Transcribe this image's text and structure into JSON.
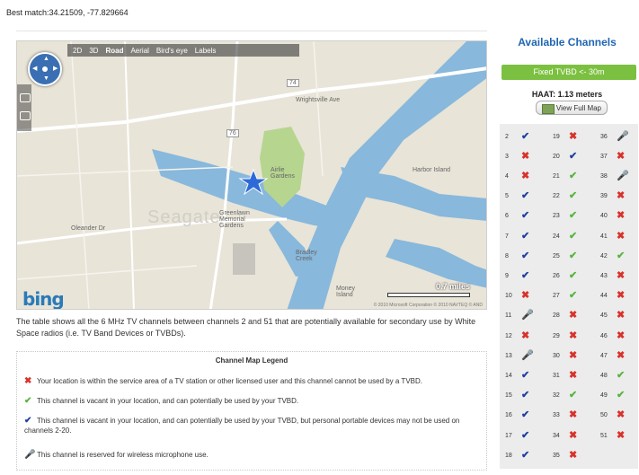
{
  "header": {
    "best_match": "Best match:34.21509, -77.829664"
  },
  "map": {
    "toolbar": [
      "2D",
      "3D",
      "Road",
      "Aerial",
      "Bird's eye",
      "Labels"
    ],
    "toolbar_active": "Road",
    "labels": {
      "town": "Seagate",
      "street1": "Wrightsville Ave",
      "street2": "Oleander Dr",
      "park": "Airlie Gardens",
      "cemetery": "Greenlawn Memorial Gardens",
      "harbor": "Harbor Island",
      "bradley": "Bradley Creek",
      "money": "Money Island",
      "route1": "74",
      "route2": "76"
    },
    "logo": "bing",
    "scale": "0.7 miles",
    "copyright": "© 2010 Microsoft Corporation   © 2010 NAVTEQ   © AND"
  },
  "description": "The table shows all the 6 MHz TV channels between channels 2 and 51 that are potentially available for secondary use by White Space radios (i.e. TV Band Devices or TVBDs).",
  "legend": {
    "title": "Channel Map Legend",
    "items": [
      {
        "icon": "x",
        "text": "Your location is within the service area of a TV station or other licensed user and this channel cannot be used by a TVBD."
      },
      {
        "icon": "g",
        "text": "This channel is vacant in your location, and can potentially be used by your TVBD."
      },
      {
        "icon": "b",
        "text": "This channel is vacant in your location, and can potentially be used by your TVBD, but personal portable devices may not be used on channels 2-20."
      },
      {
        "icon": "m",
        "text": "This channel is reserved for wireless microphone use."
      }
    ]
  },
  "panel": {
    "title": "Available Channels",
    "button": "Fixed TVBD <- 30m",
    "haat": "HAAT: 1.13 meters",
    "view_map": "View Full Map"
  },
  "icons": {
    "x": "✖",
    "g": "✔",
    "b": "✔",
    "m": "🎤"
  },
  "colors": {
    "x": "#d8322a",
    "g": "#58b43c",
    "b": "#1f3f9e",
    "m": "#444444",
    "accent": "#1f66b2",
    "button": "#7cc041"
  },
  "channels": [
    [
      [
        "2",
        "b"
      ],
      [
        "3",
        "x"
      ],
      [
        "4",
        "x"
      ],
      [
        "5",
        "b"
      ],
      [
        "6",
        "b"
      ],
      [
        "7",
        "b"
      ],
      [
        "8",
        "b"
      ],
      [
        "9",
        "b"
      ],
      [
        "10",
        "x"
      ],
      [
        "11",
        "m"
      ],
      [
        "12",
        "x"
      ],
      [
        "13",
        "m"
      ],
      [
        "14",
        "b"
      ],
      [
        "15",
        "b"
      ],
      [
        "16",
        "b"
      ],
      [
        "17",
        "b"
      ],
      [
        "18",
        "b"
      ]
    ],
    [
      [
        "19",
        "x"
      ],
      [
        "20",
        "b"
      ],
      [
        "21",
        "g"
      ],
      [
        "22",
        "g"
      ],
      [
        "23",
        "g"
      ],
      [
        "24",
        "g"
      ],
      [
        "25",
        "g"
      ],
      [
        "26",
        "g"
      ],
      [
        "27",
        "g"
      ],
      [
        "28",
        "x"
      ],
      [
        "29",
        "x"
      ],
      [
        "30",
        "x"
      ],
      [
        "31",
        "x"
      ],
      [
        "32",
        "g"
      ],
      [
        "33",
        "x"
      ],
      [
        "34",
        "x"
      ],
      [
        "35",
        "x"
      ]
    ],
    [
      [
        "36",
        "m"
      ],
      [
        "37",
        "x"
      ],
      [
        "38",
        "m"
      ],
      [
        "39",
        "x"
      ],
      [
        "40",
        "x"
      ],
      [
        "41",
        "x"
      ],
      [
        "42",
        "g"
      ],
      [
        "43",
        "x"
      ],
      [
        "44",
        "x"
      ],
      [
        "45",
        "x"
      ],
      [
        "46",
        "x"
      ],
      [
        "47",
        "x"
      ],
      [
        "48",
        "g"
      ],
      [
        "49",
        "g"
      ],
      [
        "50",
        "x"
      ],
      [
        "51",
        "x"
      ]
    ]
  ]
}
